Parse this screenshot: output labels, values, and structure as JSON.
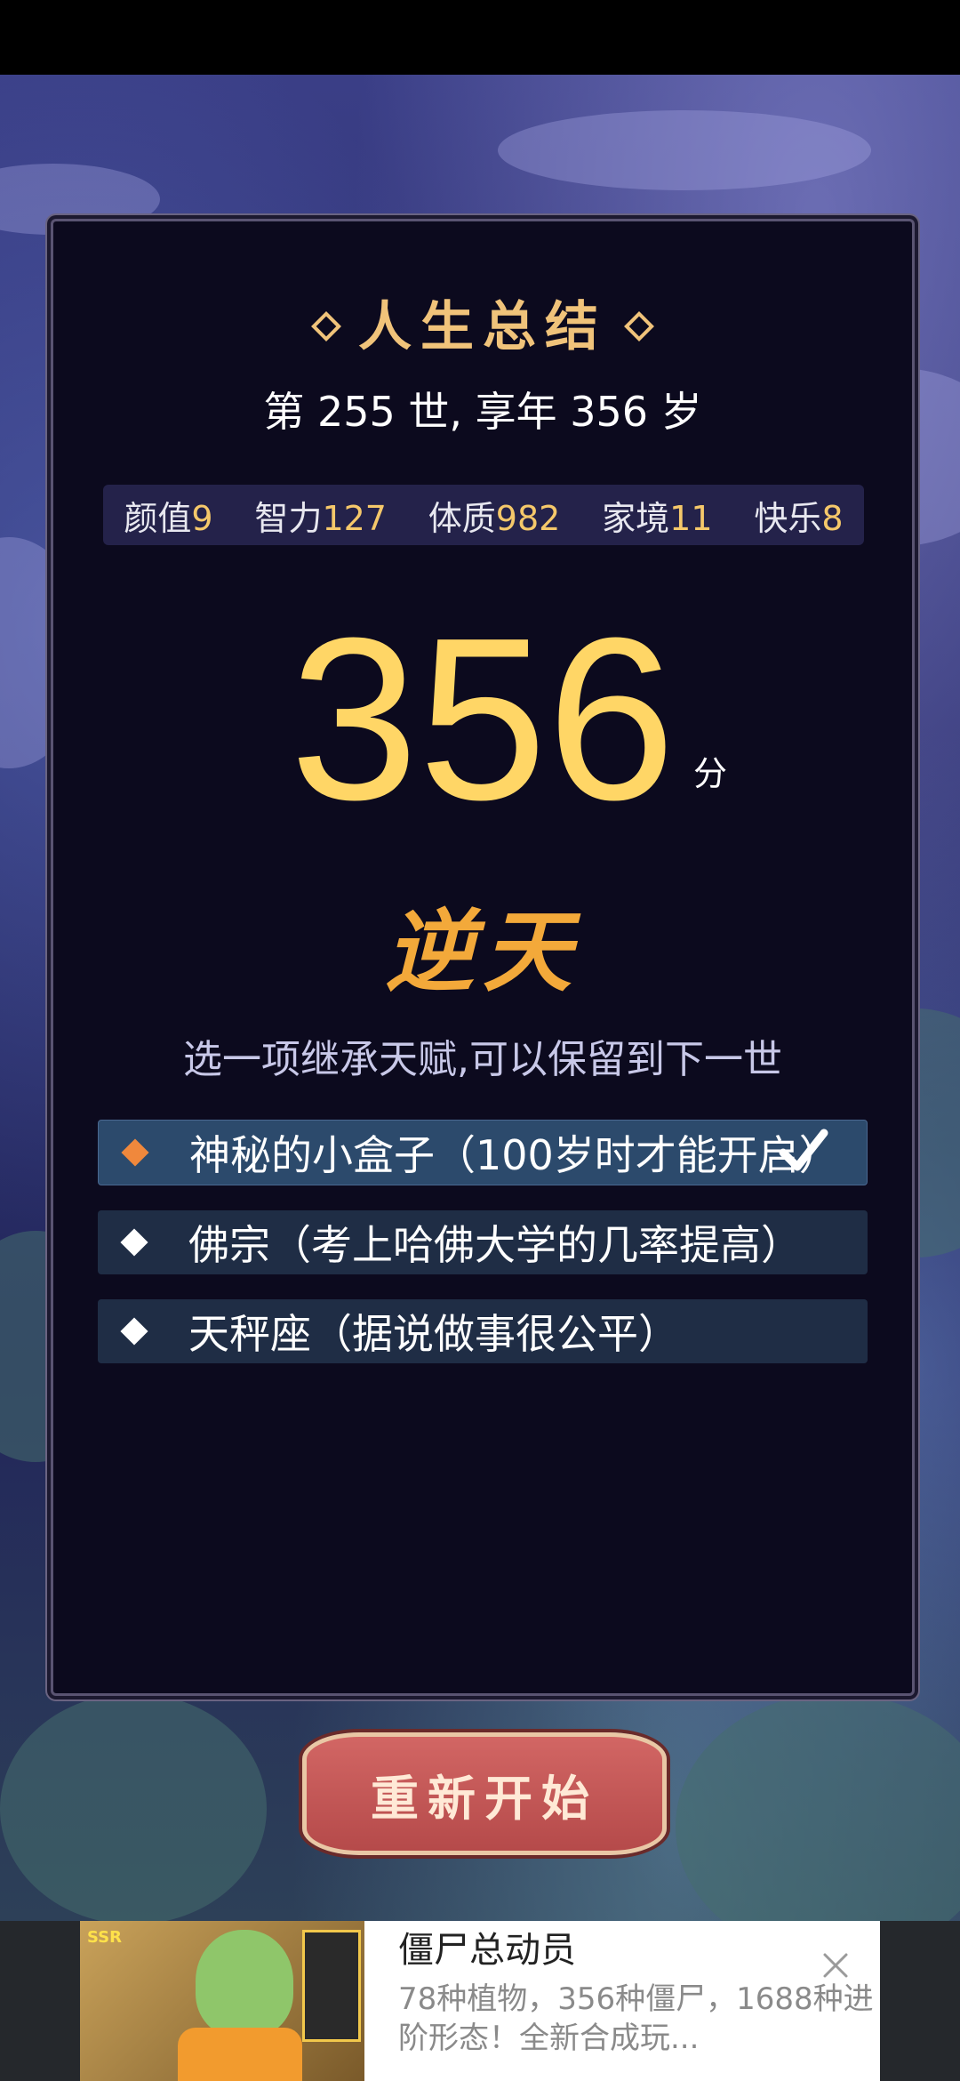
{
  "summary": {
    "title": "人生总结",
    "lifespan_text": "第 255 世, 享年 356 岁"
  },
  "attributes": [
    {
      "label": "颜值",
      "value": "9"
    },
    {
      "label": "智力",
      "value": "127"
    },
    {
      "label": "体质",
      "value": "982"
    },
    {
      "label": "家境",
      "value": "11"
    },
    {
      "label": "快乐",
      "value": "8"
    }
  ],
  "score": {
    "value": "356",
    "unit": "分",
    "rank": "逆天"
  },
  "talent_prompt": "选一项继承天赋,可以保留到下一世",
  "talents": [
    {
      "label": "神秘的小盒子（100岁时才能开启）",
      "selected": true
    },
    {
      "label": "佛宗（考上哈佛大学的几率提高）",
      "selected": false
    },
    {
      "label": "天秤座（据说做事很公平）",
      "selected": false
    }
  ],
  "restart_button": "重新开始",
  "ad": {
    "title": "僵尸总动员",
    "description": "78种植物，356种僵尸，1688种进阶形态！全新合成玩...",
    "badge": "SSR"
  },
  "colors": {
    "gold": "#ffd666",
    "accent_orange": "#f0883c",
    "panel_bg": "#0c0a1e",
    "button_red": "#c85858"
  }
}
